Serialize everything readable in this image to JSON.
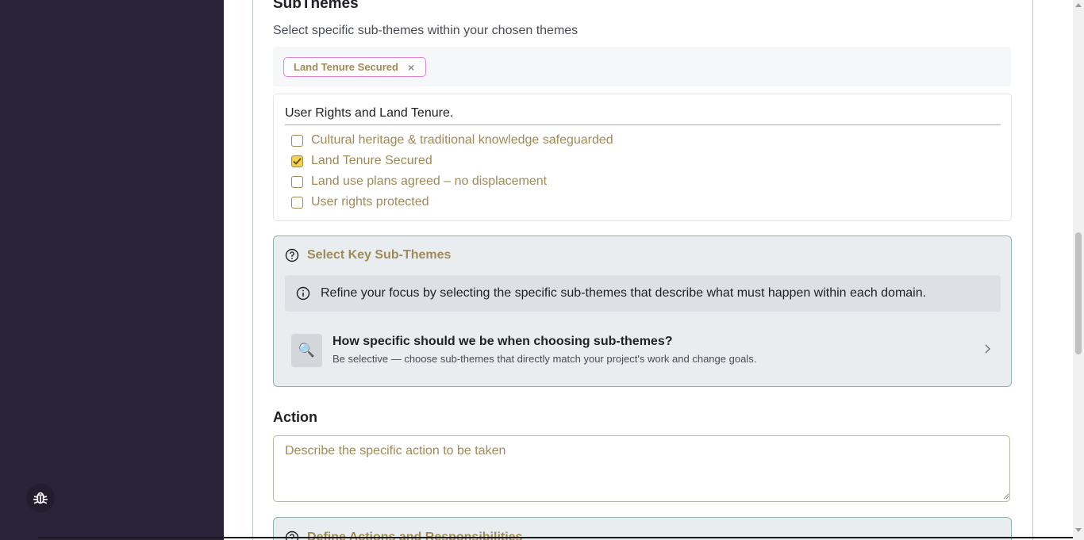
{
  "subthemes": {
    "title": "SubThemes",
    "description": "Select specific sub-themes within your chosen themes",
    "selected_chips": [
      {
        "label": "Land Tenure Secured",
        "remove_symbol": "×"
      }
    ],
    "group": {
      "title": "User Rights and Land Tenure.",
      "options": [
        {
          "label": "Cultural heritage & traditional knowledge safeguarded",
          "checked": false
        },
        {
          "label": "Land Tenure Secured",
          "checked": true
        },
        {
          "label": "Land use plans agreed – no displacement",
          "checked": false
        },
        {
          "label": "User rights protected",
          "checked": false
        }
      ]
    }
  },
  "help_panel": {
    "heading": "Select Key Sub-Themes",
    "heading_icon": "question-circle-icon",
    "info_icon": "info-circle-icon",
    "info_text": "Refine your focus by selecting the specific sub-themes that describe what must happen within each domain.",
    "tip": {
      "icon": "magnifier-icon",
      "icon_glyph": "🔍",
      "title": "How specific should we be when choosing sub-themes?",
      "subtitle": "Be selective — choose sub-themes that directly match your project's work and change goals."
    }
  },
  "action": {
    "label": "Action",
    "placeholder": "Describe the specific action to be taken",
    "value": ""
  },
  "help_panel_2": {
    "heading": "Define Actions and Responsibilities"
  },
  "colors": {
    "sidebar": "#2a2238",
    "accent_gold": "#a08a58",
    "accent_pink": "#e583d7",
    "checkbox_fill": "#f2d34a",
    "panel_border": "#8fb2ae"
  }
}
